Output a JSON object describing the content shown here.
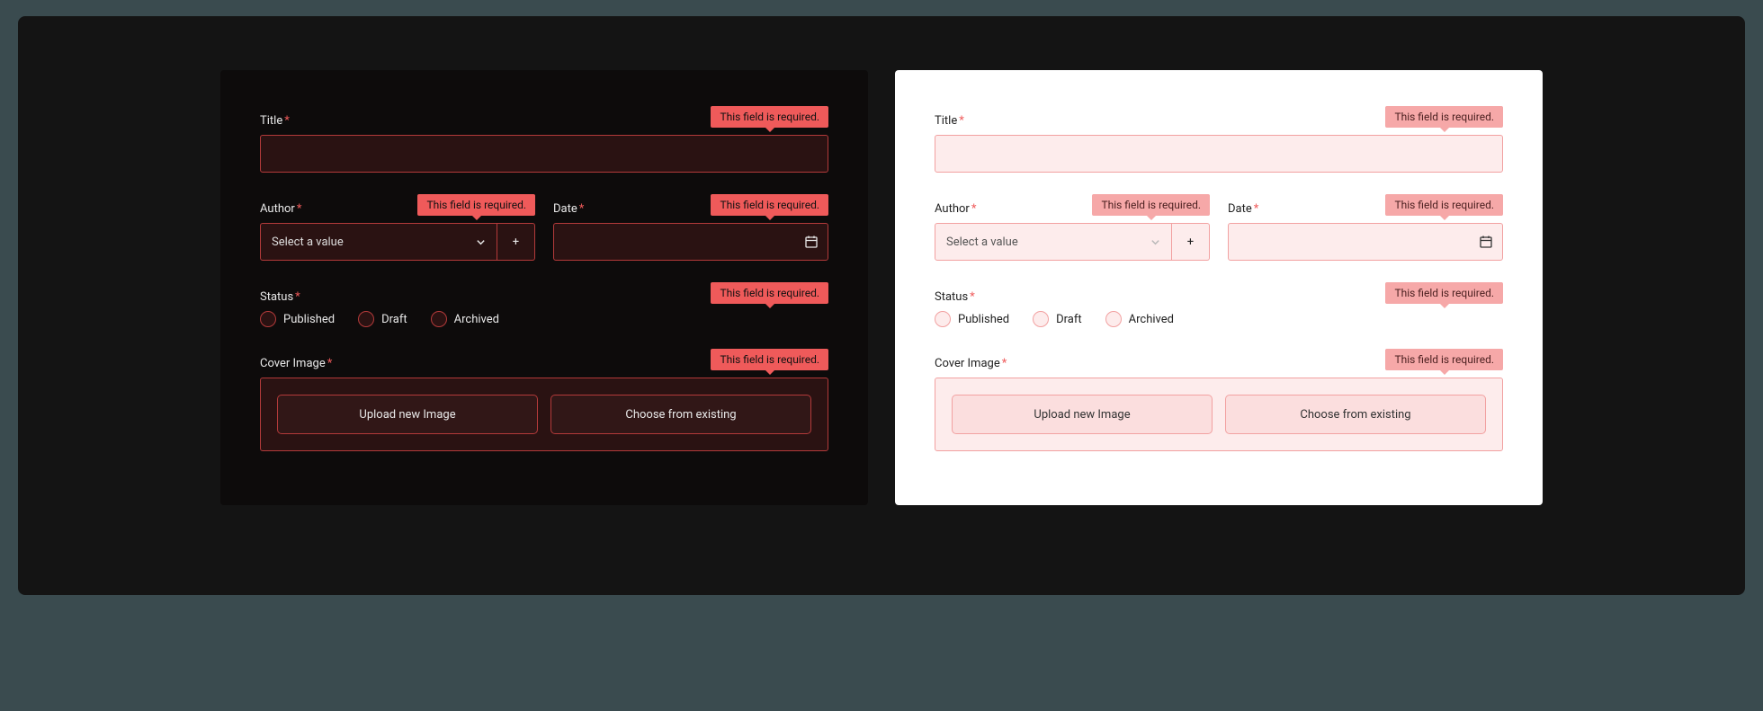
{
  "errors": {
    "required": "This field is required."
  },
  "fields": {
    "title": {
      "label": "Title"
    },
    "author": {
      "label": "Author",
      "placeholder": "Select a value"
    },
    "date": {
      "label": "Date"
    },
    "status": {
      "label": "Status",
      "options": {
        "published": "Published",
        "draft": "Draft",
        "archived": "Archived"
      }
    },
    "cover": {
      "label": "Cover Image",
      "upload": "Upload new Image",
      "choose": "Choose from existing"
    }
  },
  "glyphs": {
    "required": "*",
    "plus": "+"
  }
}
